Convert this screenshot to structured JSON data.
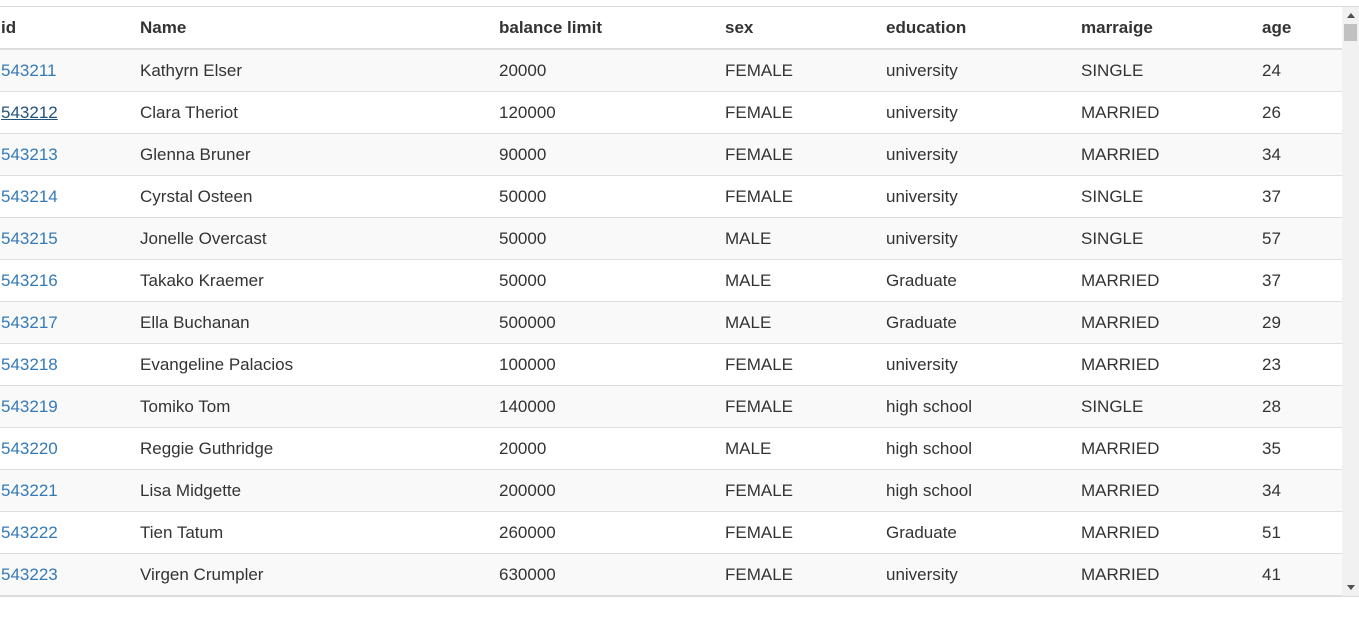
{
  "table": {
    "columns": [
      "id",
      "Name",
      "balance limit",
      "sex",
      "education",
      "marraige",
      "age"
    ],
    "rows": [
      {
        "id": "543211",
        "name": "Kathyrn Elser",
        "balance_limit": "20000",
        "sex": "FEMALE",
        "education": "university",
        "marriage": "SINGLE",
        "age": "24"
      },
      {
        "id": "543212",
        "name": "Clara Theriot",
        "balance_limit": "120000",
        "sex": "FEMALE",
        "education": "university",
        "marriage": "MARRIED",
        "age": "26"
      },
      {
        "id": "543213",
        "name": "Glenna Bruner",
        "balance_limit": "90000",
        "sex": "FEMALE",
        "education": "university",
        "marriage": "MARRIED",
        "age": "34"
      },
      {
        "id": "543214",
        "name": "Cyrstal Osteen",
        "balance_limit": "50000",
        "sex": "FEMALE",
        "education": "university",
        "marriage": "SINGLE",
        "age": "37"
      },
      {
        "id": "543215",
        "name": "Jonelle Overcast",
        "balance_limit": "50000",
        "sex": "MALE",
        "education": "university",
        "marriage": "SINGLE",
        "age": "57"
      },
      {
        "id": "543216",
        "name": "Takako Kraemer",
        "balance_limit": "50000",
        "sex": "MALE",
        "education": "Graduate",
        "marriage": "MARRIED",
        "age": "37"
      },
      {
        "id": "543217",
        "name": "Ella Buchanan",
        "balance_limit": "500000",
        "sex": "MALE",
        "education": "Graduate",
        "marriage": "MARRIED",
        "age": "29"
      },
      {
        "id": "543218",
        "name": "Evangeline Palacios",
        "balance_limit": "100000",
        "sex": "FEMALE",
        "education": "university",
        "marriage": "MARRIED",
        "age": "23"
      },
      {
        "id": "543219",
        "name": "Tomiko Tom",
        "balance_limit": "140000",
        "sex": "FEMALE",
        "education": "high school",
        "marriage": "SINGLE",
        "age": "28"
      },
      {
        "id": "543220",
        "name": "Reggie Guthridge",
        "balance_limit": "20000",
        "sex": "MALE",
        "education": "high school",
        "marriage": "MARRIED",
        "age": "35"
      },
      {
        "id": "543221",
        "name": "Lisa Midgette",
        "balance_limit": "200000",
        "sex": "FEMALE",
        "education": "high school",
        "marriage": "MARRIED",
        "age": "34"
      },
      {
        "id": "543222",
        "name": "Tien Tatum",
        "balance_limit": "260000",
        "sex": "FEMALE",
        "education": "Graduate",
        "marriage": "MARRIED",
        "age": "51"
      },
      {
        "id": "543223",
        "name": "Virgen Crumpler",
        "balance_limit": "630000",
        "sex": "FEMALE",
        "education": "university",
        "marriage": "MARRIED",
        "age": "41"
      }
    ],
    "hovered_id": "543212"
  },
  "icons": {
    "scroll_up": "scroll-up-arrow-icon",
    "scroll_down": "scroll-down-arrow-icon"
  },
  "colors": {
    "link": "#337ab7",
    "link_hover": "#23527c",
    "stripe": "#f9f9f9",
    "border": "#dddddd"
  }
}
